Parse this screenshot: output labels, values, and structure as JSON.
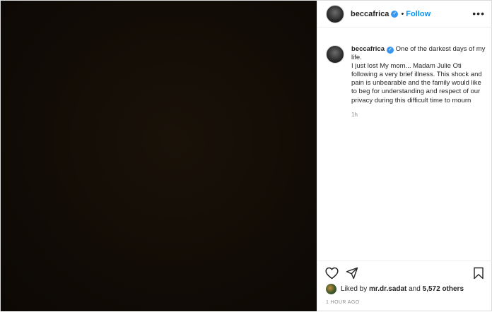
{
  "post": {
    "username": "beccafrica",
    "verified": true,
    "follow_label": "Follow",
    "separator": "•",
    "more_icon": "more-horizontal-icon",
    "caption": "One of the darkest days of my life.\nI just lost My mom... Madam Julie Oti following a very brief illness. This shock and pain is unbearable and the family would like to beg for understanding and respect of our privacy during this difficult time to mourn",
    "caption_time": "1h",
    "liked_by_prefix": "Liked by",
    "liked_by_user": "mr.dr.sadat",
    "liked_by_joiner": "and",
    "liked_by_others": "5,572 others",
    "posted_time": "1 HOUR AGO",
    "icons": {
      "like": "heart-outline-icon",
      "share": "paper-plane-icon",
      "save": "bookmark-icon",
      "verified": "verified-badge-icon"
    },
    "colors": {
      "link": "#0095f6",
      "verified": "#3897f0",
      "muted": "#8e8e8e",
      "text": "#262626"
    }
  }
}
